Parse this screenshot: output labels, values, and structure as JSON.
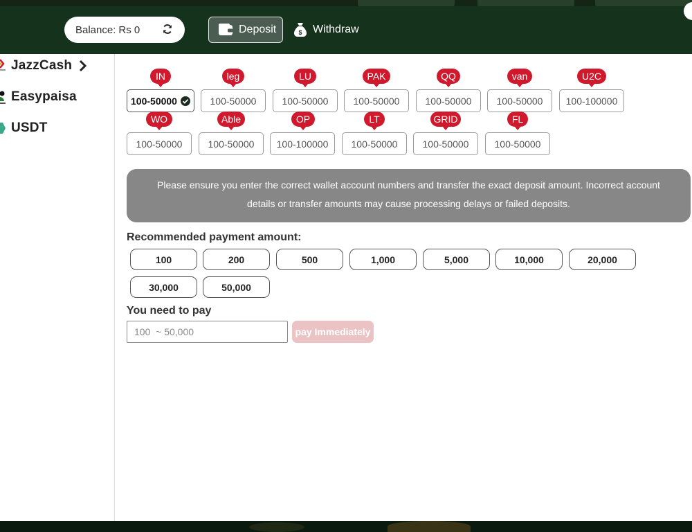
{
  "header": {
    "balance_label": "Balance:",
    "balance_value": "Rs 0",
    "deposit_label": "Deposit",
    "withdraw_label": "Withdraw",
    "icons": [
      "refresh-icon",
      "wallet-icon",
      "money-bag-icon"
    ]
  },
  "background": {
    "tabs": [
      "Deposit",
      "Withdraw",
      "Rs 0"
    ]
  },
  "sidebar": {
    "items": [
      {
        "label": "JazzCash",
        "icon": "jazzcash-logo",
        "selected": true
      },
      {
        "label": "Easypaisa",
        "icon": "easypaisa-logo",
        "selected": false
      },
      {
        "label": "USDT",
        "icon": "usdt-logo",
        "selected": false
      }
    ]
  },
  "channels": [
    {
      "tag": "IN",
      "range": "100-50000",
      "selected": true
    },
    {
      "tag": "leg",
      "range": "100-50000"
    },
    {
      "tag": "LU",
      "range": "100-50000"
    },
    {
      "tag": "PAK",
      "range": "100-50000"
    },
    {
      "tag": "QQ",
      "range": "100-50000"
    },
    {
      "tag": "van",
      "range": "100-50000"
    },
    {
      "tag": "U2C",
      "range": "100-100000"
    },
    {
      "tag": "WO",
      "range": "100-50000"
    },
    {
      "tag": "Able",
      "range": "100-50000"
    },
    {
      "tag": "OP",
      "range": "100-100000"
    },
    {
      "tag": "LT",
      "range": "100-50000"
    },
    {
      "tag": "GRID",
      "range": "100-50000"
    },
    {
      "tag": "FL",
      "range": "100-50000"
    }
  ],
  "notice": {
    "text": "Please ensure you enter the correct wallet account numbers and transfer the exact deposit amount. Incorrect account details or transfer amounts may cause processing delays or failed deposits."
  },
  "recommended": {
    "label": "Recommended payment amount:",
    "amounts": [
      "100",
      "200",
      "500",
      "1,000",
      "5,000",
      "10,000",
      "20,000",
      "30,000",
      "50,000"
    ]
  },
  "pay": {
    "label": "You need to pay",
    "placeholder": "100  ~ 50,000",
    "button_label": "pay Immediately"
  },
  "colors": {
    "header_bg": "#14321c",
    "tag_red": "#d0192c",
    "notice_bg": "#878787",
    "pay_button_disabled": "#ecc3c5"
  }
}
